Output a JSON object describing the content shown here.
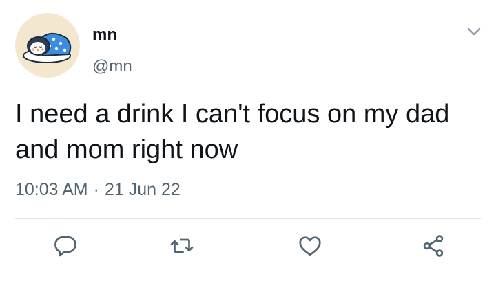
{
  "author": {
    "display_name": "mn",
    "handle": "@mn",
    "avatar_icon": "penguin-sleeping-avatar"
  },
  "tweet": {
    "text": "I need a drink I can't focus on my dad and mom right now",
    "time": "10:03 AM",
    "separator": "·",
    "date": "21 Jun 22"
  },
  "icons": {
    "menu": "chevron-down-icon",
    "reply": "reply-icon",
    "retweet": "retweet-icon",
    "like": "heart-icon",
    "share": "share-icon"
  },
  "colors": {
    "text": "#0f1419",
    "secondary": "#536471",
    "icon": "#536471",
    "divider": "#dfe3e6",
    "avatar_bg": "#f3e8cf"
  }
}
